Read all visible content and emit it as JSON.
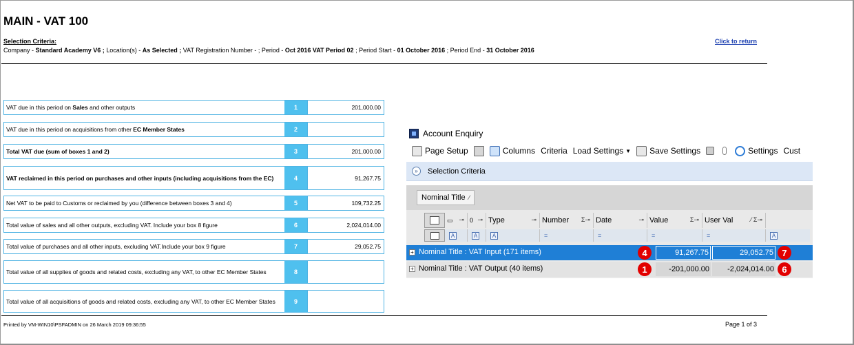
{
  "report": {
    "title": "MAIN - VAT 100",
    "criteria_heading": "Selection Criteria:",
    "criteria": {
      "company_label": "Company - ",
      "company_value": "Standard Academy V6 ;",
      "locations_label": "  Location(s) - ",
      "locations_value": "As Selected ;",
      "vatreg_label": " VAT Registration Number -  ;",
      "period_label": " Period - ",
      "period_value": "Oct 2016 VAT Period 02",
      "period_start_label": " ; Period Start - ",
      "period_start_value": "01 October 2016",
      "period_end_label": " ; Period End - ",
      "period_end_value": "31 October 2016"
    },
    "return_link": "Click to return",
    "printed_by": "Printed by VM-WIN10\\PSFADMIN on 26 March 2019 09:36:55",
    "page": "Page 1 of 3"
  },
  "vat_boxes": [
    {
      "desc_pre": "VAT due in this period on ",
      "desc_bold": "Sales",
      "desc_post": " and other outputs",
      "num": "1",
      "value": "201,000.00"
    },
    {
      "desc_pre": "VAT due in this period on acquisitions from other ",
      "desc_bold": "EC Member States",
      "desc_post": "",
      "num": "2",
      "value": ""
    },
    {
      "desc": "Total VAT due (sum of boxes 1 and 2)",
      "num": "3",
      "value": "201,000.00"
    },
    {
      "desc": "VAT reclaimed in this period on purchases and other inputs (including acquisitions from the EC)",
      "num": "4",
      "value": "91,267.75"
    },
    {
      "desc": "Net VAT to be paid to Customs or reclaimed by you (difference between boxes 3 and 4)",
      "num": "5",
      "value": "109,732.25"
    },
    {
      "desc": "Total value of sales and all other outputs, excluding VAT. Include your box 8 figure",
      "num": "6",
      "value": "2,024,014.00"
    },
    {
      "desc": "Total value of purchases and all other inputs, excluding VAT.Include your box 9 figure",
      "num": "7",
      "value": "29,052.75"
    },
    {
      "desc": "Total value of all supplies  of goods and related costs, excluding any VAT, to other EC Member States",
      "num": "8",
      "value": ""
    },
    {
      "desc": "Total value of all acquisitions of goods and related costs, excluding any VAT, to other EC Member States",
      "num": "9",
      "value": ""
    }
  ],
  "account_enquiry": {
    "window_title": "Account Enquiry",
    "toolbar": {
      "page_setup": "Page Setup",
      "columns": "Columns",
      "criteria": "Criteria",
      "load_settings": "Load Settings",
      "save_settings": "Save Settings",
      "settings": "Settings",
      "cust_truncated": "Cust"
    },
    "selection_criteria": "Selection Criteria",
    "group_by": "Nominal Title",
    "columns": {
      "type": "Type",
      "number": "Number",
      "date": "Date",
      "value": "Value",
      "user_val": "User Val"
    },
    "rows": [
      {
        "label": "Nominal Title : VAT Input (171 items)",
        "value": "91,267.75",
        "user_val": "29,052.75",
        "badge_left": "4",
        "badge_right": "7"
      },
      {
        "label": "Nominal Title : VAT Output (40 items)",
        "value": "-201,000.00",
        "user_val": "-2,024,014.00",
        "badge_left": "1",
        "badge_right": "6"
      }
    ]
  },
  "colors": {
    "box_border": "#4fb3e3",
    "box_number_bg": "#4fc0ee",
    "selected_row": "#1f7fd6",
    "badge": "#e20000",
    "link": "#1b3fb0"
  }
}
